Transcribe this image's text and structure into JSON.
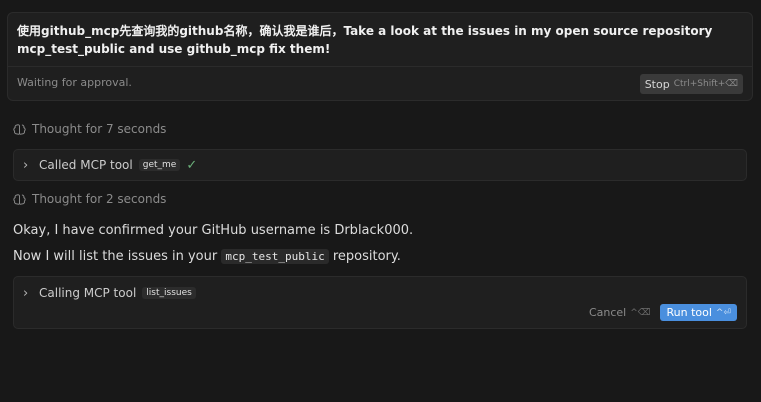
{
  "prompt": {
    "text": "使用github_mcp先查询我的github名称，确认我是谁后，Take a look at the issues in my open source repository mcp_test_public and use github_mcp fix them!",
    "status": "Waiting for approval.",
    "stop_label": "Stop",
    "stop_shortcut": "Ctrl+Shift+⌫"
  },
  "thought1": {
    "label": "Thought for 7 seconds"
  },
  "tool1": {
    "label": "Called MCP tool",
    "tool_name": "get_me",
    "status_icon": "check-icon"
  },
  "thought2": {
    "label": "Thought for 2 seconds"
  },
  "message": {
    "line1": "Okay, I have confirmed your GitHub username is Drblack000.",
    "line2_pre": "Now I will list the issues in your",
    "line2_code": "mcp_test_public",
    "line2_post": "repository."
  },
  "tool2": {
    "label": "Calling MCP tool",
    "tool_name": "list_issues",
    "cancel_label": "Cancel",
    "cancel_shortcut": "^⌫",
    "run_label": "Run tool",
    "run_shortcut": "^⏎"
  },
  "colors": {
    "accent": "#4a8fde",
    "success": "#6bb07a",
    "background": "#181818"
  }
}
